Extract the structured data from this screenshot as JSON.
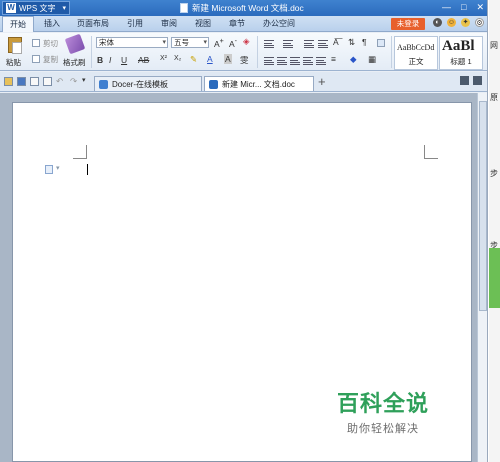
{
  "titlebar": {
    "app_name": "WPS 文字",
    "app_logo": "W",
    "doc_title": "新建 Microsoft Word 文档.doc",
    "controls": [
      "—",
      "□",
      "✕"
    ]
  },
  "menu": {
    "tabs": [
      "开始",
      "插入",
      "页面布局",
      "引用",
      "审阅",
      "视图",
      "章节",
      "办公空间"
    ],
    "active": "开始",
    "login": "未登录",
    "help": "?"
  },
  "ribbon": {
    "paste": "粘贴",
    "cut": "剪切",
    "copy": "复制",
    "format_painter": "格式刷",
    "font_name": "宋体",
    "font_size": "五号",
    "bold": "B",
    "italic": "I",
    "underline": "U",
    "strike": "AB",
    "styles": [
      {
        "sample": "AaBbCcDd",
        "name": "正文"
      },
      {
        "sample": "AaBl",
        "name": "标题 1"
      }
    ]
  },
  "tabs": [
    {
      "label": "Docer-在线模板",
      "active": false,
      "color": "#3f7fd0"
    },
    {
      "label": "新建 Micr... 文档.doc",
      "active": true,
      "color": "#2b6bbd"
    }
  ],
  "new_tab": "+",
  "watermark": {
    "title": "百科全说",
    "subtitle": "助你轻松解决"
  },
  "edge": {
    "texts": [
      "网",
      "原",
      "步",
      "步"
    ]
  }
}
